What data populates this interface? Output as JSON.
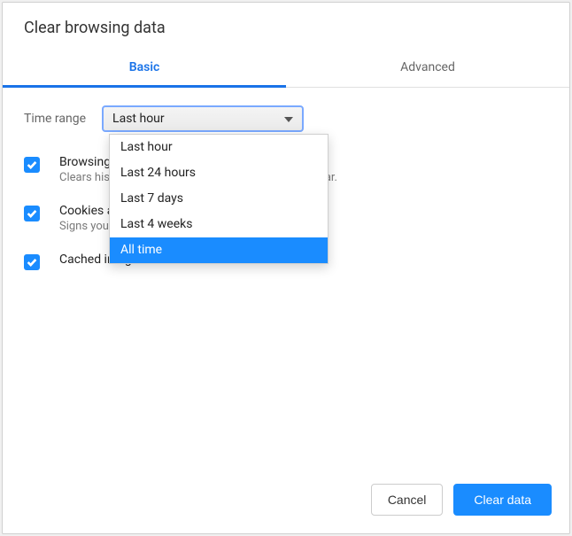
{
  "title": "Clear browsing data",
  "tabs": {
    "basic": "Basic",
    "advanced": "Advanced"
  },
  "timeRange": {
    "label": "Time range",
    "selected": "Last hour",
    "options": [
      "Last hour",
      "Last 24 hours",
      "Last 7 days",
      "Last 4 weeks",
      "All time"
    ],
    "highlighted": "All time"
  },
  "items": [
    {
      "label": "Browsing history",
      "sub": "Clears history and autocompletions in the address bar."
    },
    {
      "label": "Cookies and other site data",
      "sub": "Signs you out of most sites."
    },
    {
      "label": "Cached images and files",
      "sub": ""
    }
  ],
  "buttons": {
    "cancel": "Cancel",
    "clear": "Clear data"
  }
}
